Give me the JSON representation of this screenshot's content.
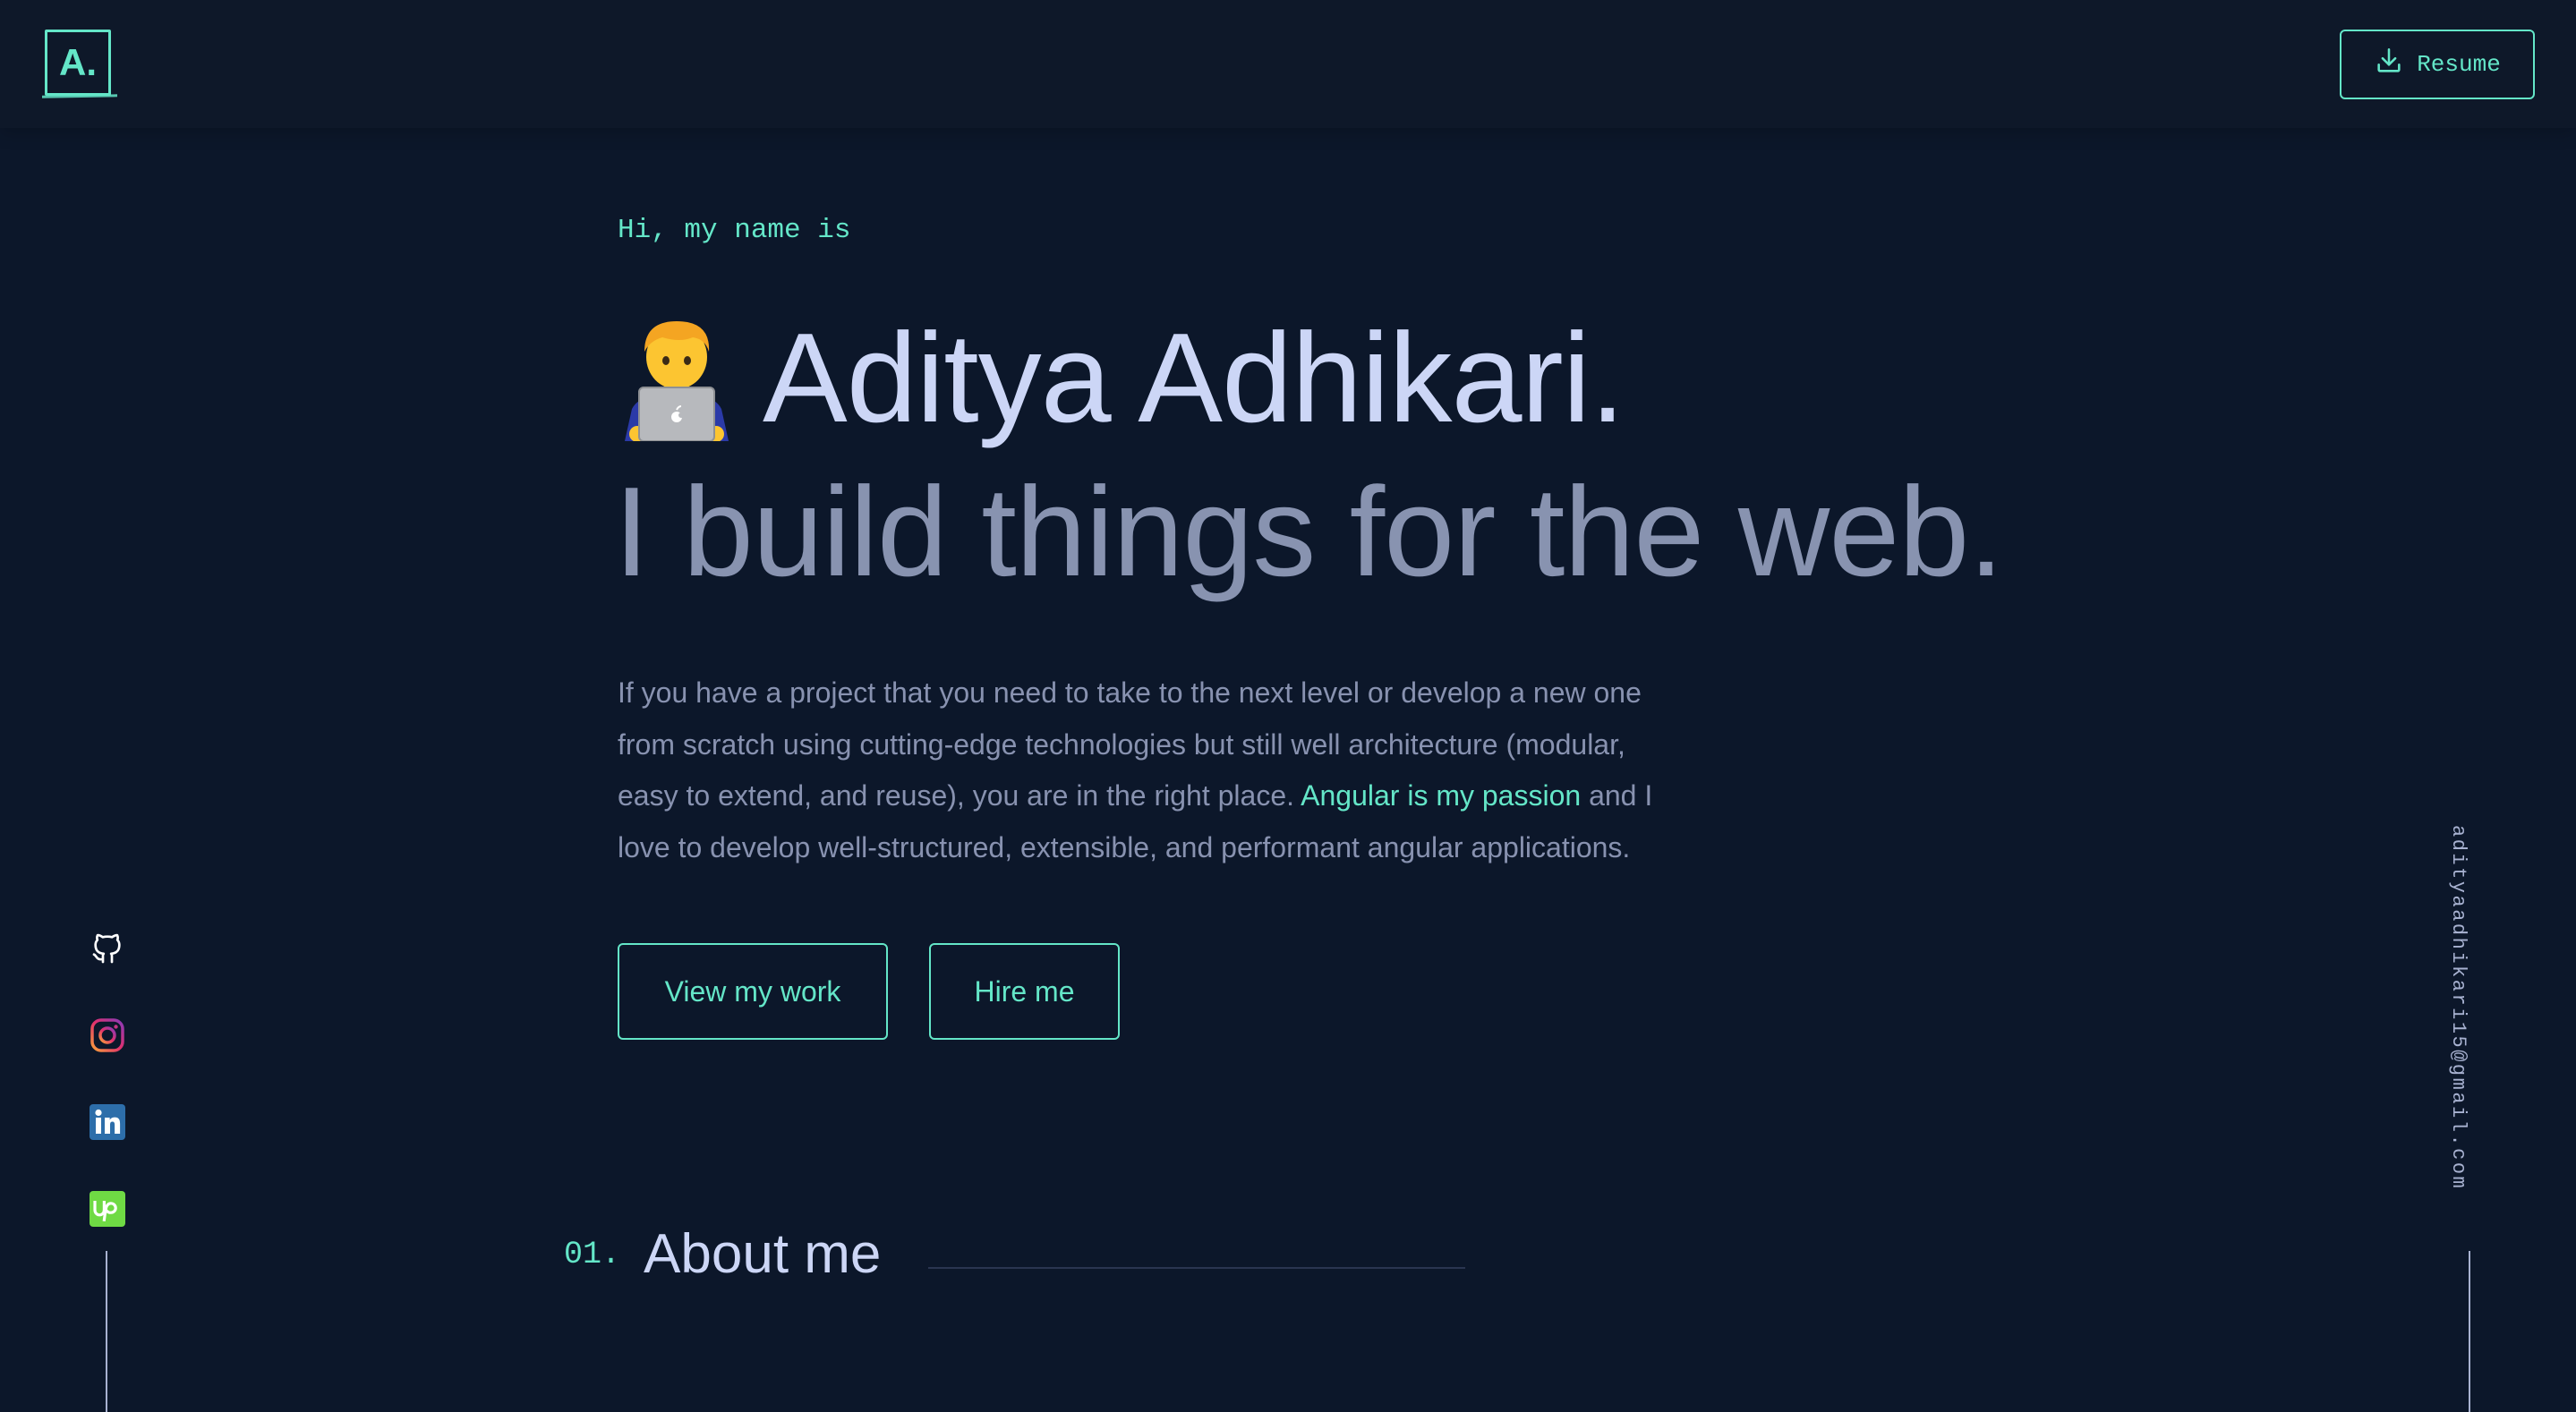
{
  "header": {
    "logo_text": "A.",
    "resume_label": "Resume",
    "resume_icon": "download-icon"
  },
  "hero": {
    "greeting": "Hi, my name is",
    "emoji": "technologist-emoji",
    "name": "Aditya Adhikari.",
    "tagline": "I build things for the web.",
    "intro_before": "If you have a project that you need to take to the next level or develop a new one from scratch using cutting-edge technologies but still well architecture (modular, easy to extend, and reuse), you are in the right place. ",
    "intro_accent": "Angular is my passion",
    "intro_after": " and I love to develop well-structured, extensible, and performant angular applications.",
    "buttons": {
      "view_work": "View my work",
      "hire_me": "Hire me"
    }
  },
  "about": {
    "number": "01.",
    "title": "About me"
  },
  "social": [
    {
      "name": "github-icon"
    },
    {
      "name": "instagram-icon"
    },
    {
      "name": "linkedin-icon"
    },
    {
      "name": "upwork-icon"
    }
  ],
  "email": "adityaadhikari15@gmail.com",
  "colors": {
    "background": "#0c172a",
    "accent": "#64e6c8",
    "heading": "#ccd6f6",
    "muted": "#8892b0"
  }
}
